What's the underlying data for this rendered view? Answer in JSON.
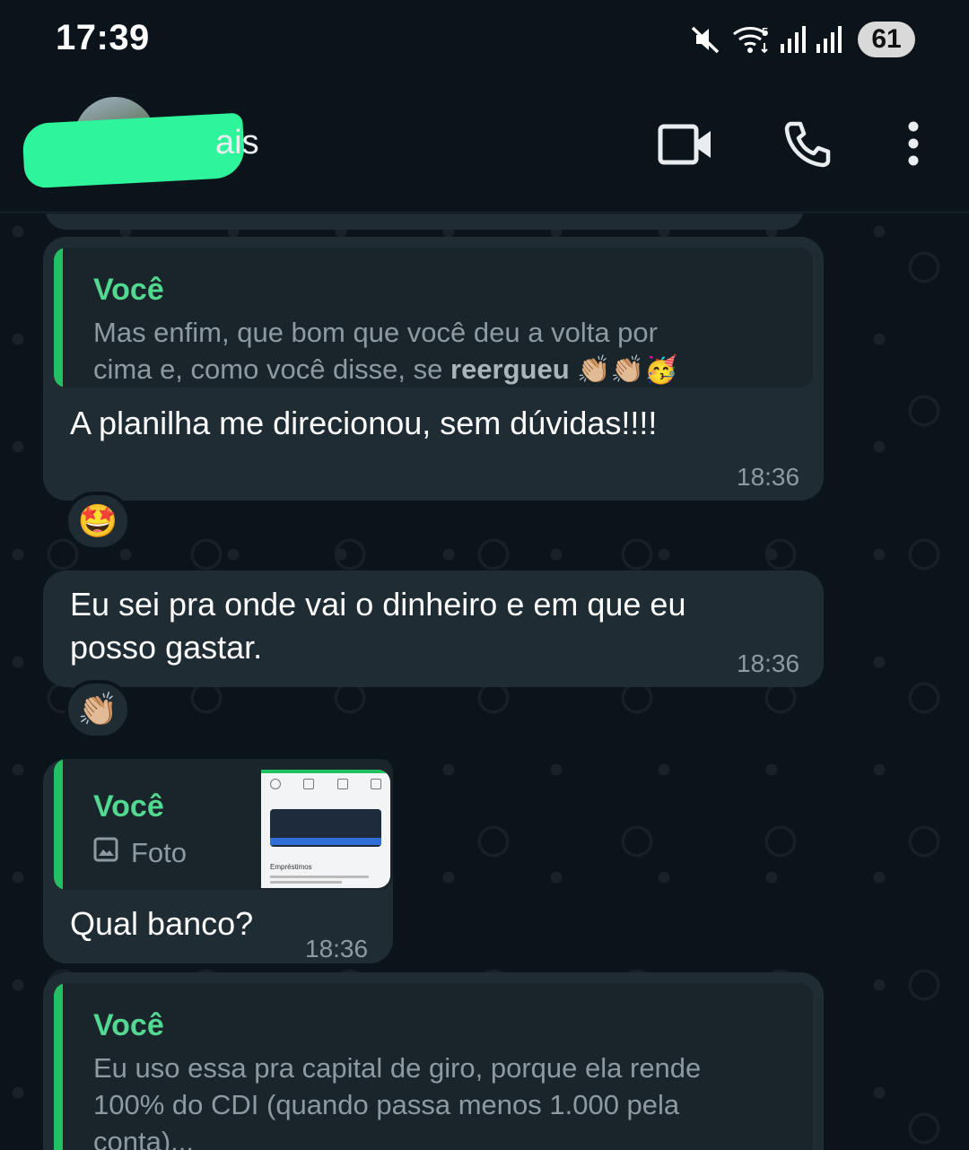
{
  "status_bar": {
    "time": "17:39",
    "battery": "61",
    "icons": [
      "mute-icon",
      "wifi-5-icon",
      "signal-icon",
      "signal-icon"
    ]
  },
  "header": {
    "contact_name_visible": "ais",
    "icons": [
      "back-arrow-icon",
      "video-call-icon",
      "voice-call-icon",
      "more-options-icon"
    ]
  },
  "messages": [
    {
      "quote_author": "Você",
      "quote_text_line1": "Mas enfim, que bom que você deu a volta por",
      "quote_text_line2_prefix": "cima e, como você disse, se ",
      "quote_text_line2_bold": "reergueu",
      "quote_emojis": "👏🏼👏🏼🥳",
      "text": "A planilha me direcionou, sem dúvidas!!!!",
      "time": "18:36",
      "reaction": "🤩"
    },
    {
      "text_line1": "Eu sei pra onde vai o dinheiro e em que eu",
      "text_line2": "posso gastar.",
      "time": "18:36",
      "reaction": "👏🏼"
    },
    {
      "quote_author": "Você",
      "quote_text": "Foto",
      "thumb_label": "Empréstimos",
      "text": "Qual banco?",
      "time": "18:36"
    },
    {
      "quote_author": "Você",
      "quote_text_line1": "Eu uso essa pra capital de giro, porque ela rende",
      "quote_text_line2": "100% do CDI (quando passa menos 1.000 pela",
      "quote_text_line3": "conta)..."
    }
  ],
  "colors": {
    "background": "#0b141a",
    "bubble": "#1f2c34",
    "quote_bar": "#21c063",
    "quote_author": "#53d891",
    "redaction": "#2ef59b"
  }
}
